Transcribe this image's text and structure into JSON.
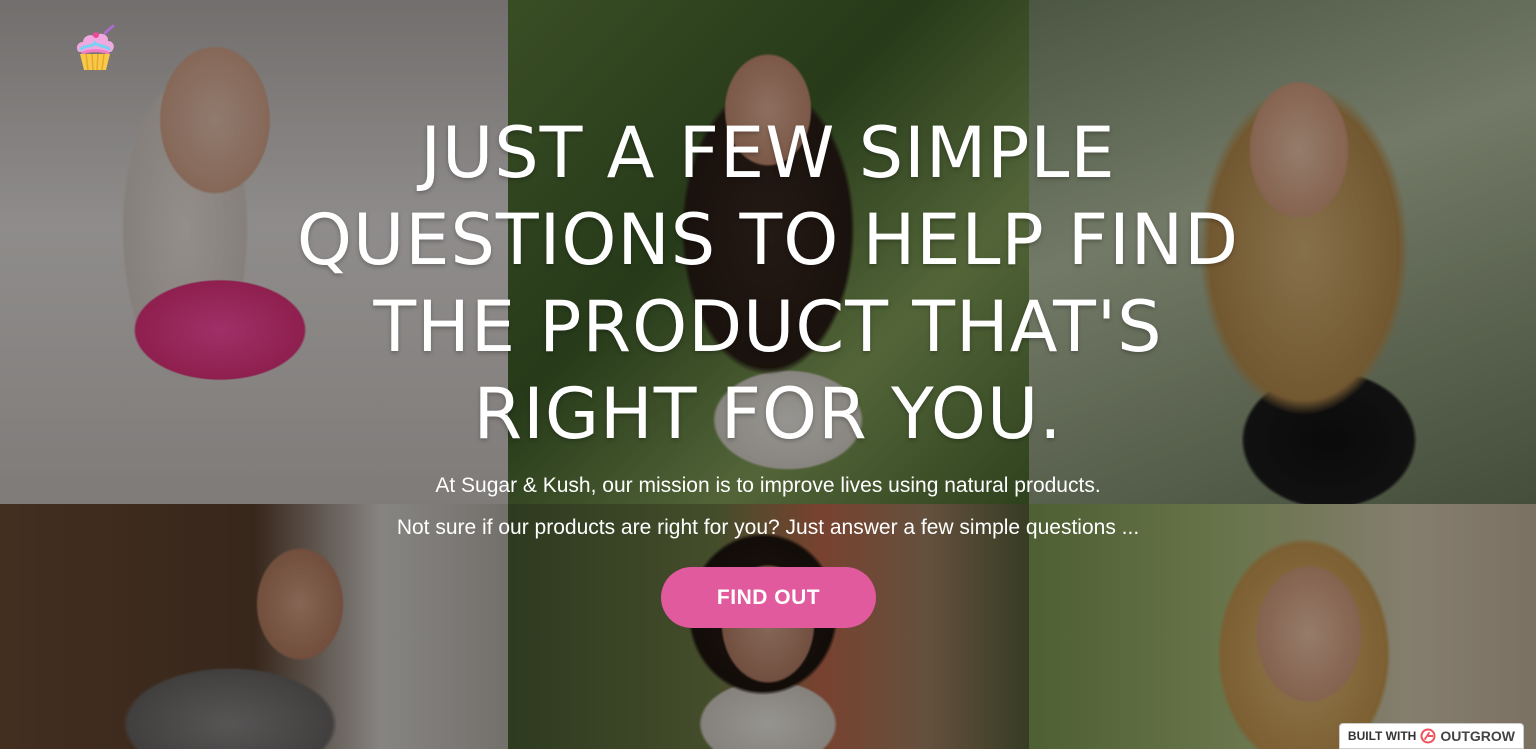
{
  "headline": "JUST A FEW SIMPLE\nQUESTIONS TO HELP FIND\nTHE  PRODUCT THAT'S\nRIGHT FOR YOU.",
  "subtitle_line1": "At Sugar & Kush, our mission is to improve lives using natural products.",
  "subtitle_line2": "Not sure if our products are right for you? Just answer a few simple questions ...",
  "cta_label": "FIND OUT",
  "footer": {
    "built_with": "BUILT WITH",
    "brand": "OUTGROW"
  },
  "logo_icon": "cupcake-icon",
  "colors": {
    "cta_bg": "#e05a9d",
    "text": "#ffffff"
  }
}
